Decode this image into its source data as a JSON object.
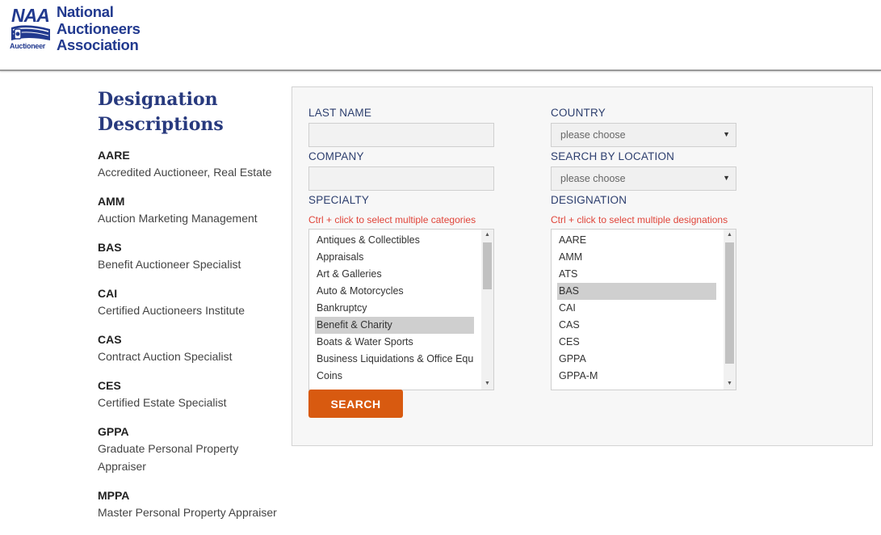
{
  "logo": {
    "mark_text": "NAA",
    "mark_sub": "Auctioneer",
    "line1": "National",
    "line2": "Auctioneers",
    "line3": "Association",
    "brand_color": "#223a8f"
  },
  "sidebar": {
    "title_line1": "Designation",
    "title_line2": "Descriptions",
    "items": [
      {
        "code": "AARE",
        "desc": "Accredited Auctioneer, Real Estate"
      },
      {
        "code": "AMM",
        "desc": "Auction Marketing Management"
      },
      {
        "code": "BAS",
        "desc": "Benefit Auctioneer Specialist"
      },
      {
        "code": "CAI",
        "desc": "Certified Auctioneers Institute"
      },
      {
        "code": "CAS",
        "desc": "Contract Auction Specialist"
      },
      {
        "code": "CES",
        "desc": "Certified Estate Specialist"
      },
      {
        "code": "GPPA",
        "desc": "Graduate Personal Property Appraiser"
      },
      {
        "code": "MPPA",
        "desc": "Master Personal Property Appraiser"
      }
    ]
  },
  "form": {
    "last_name": {
      "label": "LAST NAME",
      "value": ""
    },
    "company": {
      "label": "COMPANY",
      "value": ""
    },
    "specialty": {
      "label": "SPECIALTY",
      "hint": "Ctrl + click to select multiple categories",
      "options": [
        {
          "label": "Antiques & Collectibles",
          "selected": false
        },
        {
          "label": "Appraisals",
          "selected": false
        },
        {
          "label": "Art & Galleries",
          "selected": false
        },
        {
          "label": "Auto & Motorcycles",
          "selected": false
        },
        {
          "label": "Bankruptcy",
          "selected": false
        },
        {
          "label": "Benefit & Charity",
          "selected": true
        },
        {
          "label": "Boats & Water Sports",
          "selected": false
        },
        {
          "label": "Business Liquidations & Office Equipr",
          "selected": false
        },
        {
          "label": "Coins",
          "selected": false
        }
      ]
    },
    "country": {
      "label": "COUNTRY",
      "selected": "please choose"
    },
    "location": {
      "label": "SEARCH BY LOCATION",
      "selected": "please choose"
    },
    "designation": {
      "label": "DESIGNATION",
      "hint": "Ctrl + click to select multiple designations",
      "options": [
        {
          "label": "AARE",
          "selected": false
        },
        {
          "label": "AMM",
          "selected": false
        },
        {
          "label": "ATS",
          "selected": false
        },
        {
          "label": "BAS",
          "selected": true
        },
        {
          "label": "CAI",
          "selected": false
        },
        {
          "label": "CAS",
          "selected": false
        },
        {
          "label": "CES",
          "selected": false
        },
        {
          "label": "GPPA",
          "selected": false
        },
        {
          "label": "GPPA-M",
          "selected": false
        }
      ]
    },
    "search_label": "SEARCH",
    "button_color": "#d85a10",
    "hint_color": "#e0453a"
  }
}
